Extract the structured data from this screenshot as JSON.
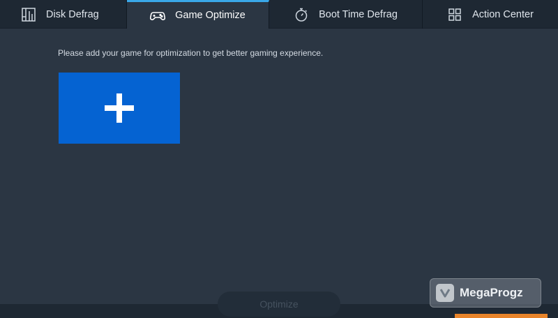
{
  "tabs": [
    {
      "label": "Disk Defrag",
      "icon": "disk-defrag-icon",
      "active": false
    },
    {
      "label": "Game Optimize",
      "icon": "gamepad-icon",
      "active": true
    },
    {
      "label": "Boot Time Defrag",
      "icon": "stopwatch-icon",
      "active": false
    },
    {
      "label": "Action Center",
      "icon": "grid-icon",
      "active": false
    }
  ],
  "main": {
    "hint_text": "Please add your game for optimization to get better gaming experience.",
    "add_tile_icon": "plus-icon"
  },
  "footer": {
    "optimize_label": "Optimize",
    "optimize_enabled": false
  },
  "watermark": {
    "text": "MegaProgz"
  },
  "colors": {
    "background": "#2b3643",
    "tabbar": "#1e2833",
    "active_tab_accent": "#3aa8e8",
    "add_tile": "#0563d2",
    "orange_accent": "#e8842a"
  }
}
